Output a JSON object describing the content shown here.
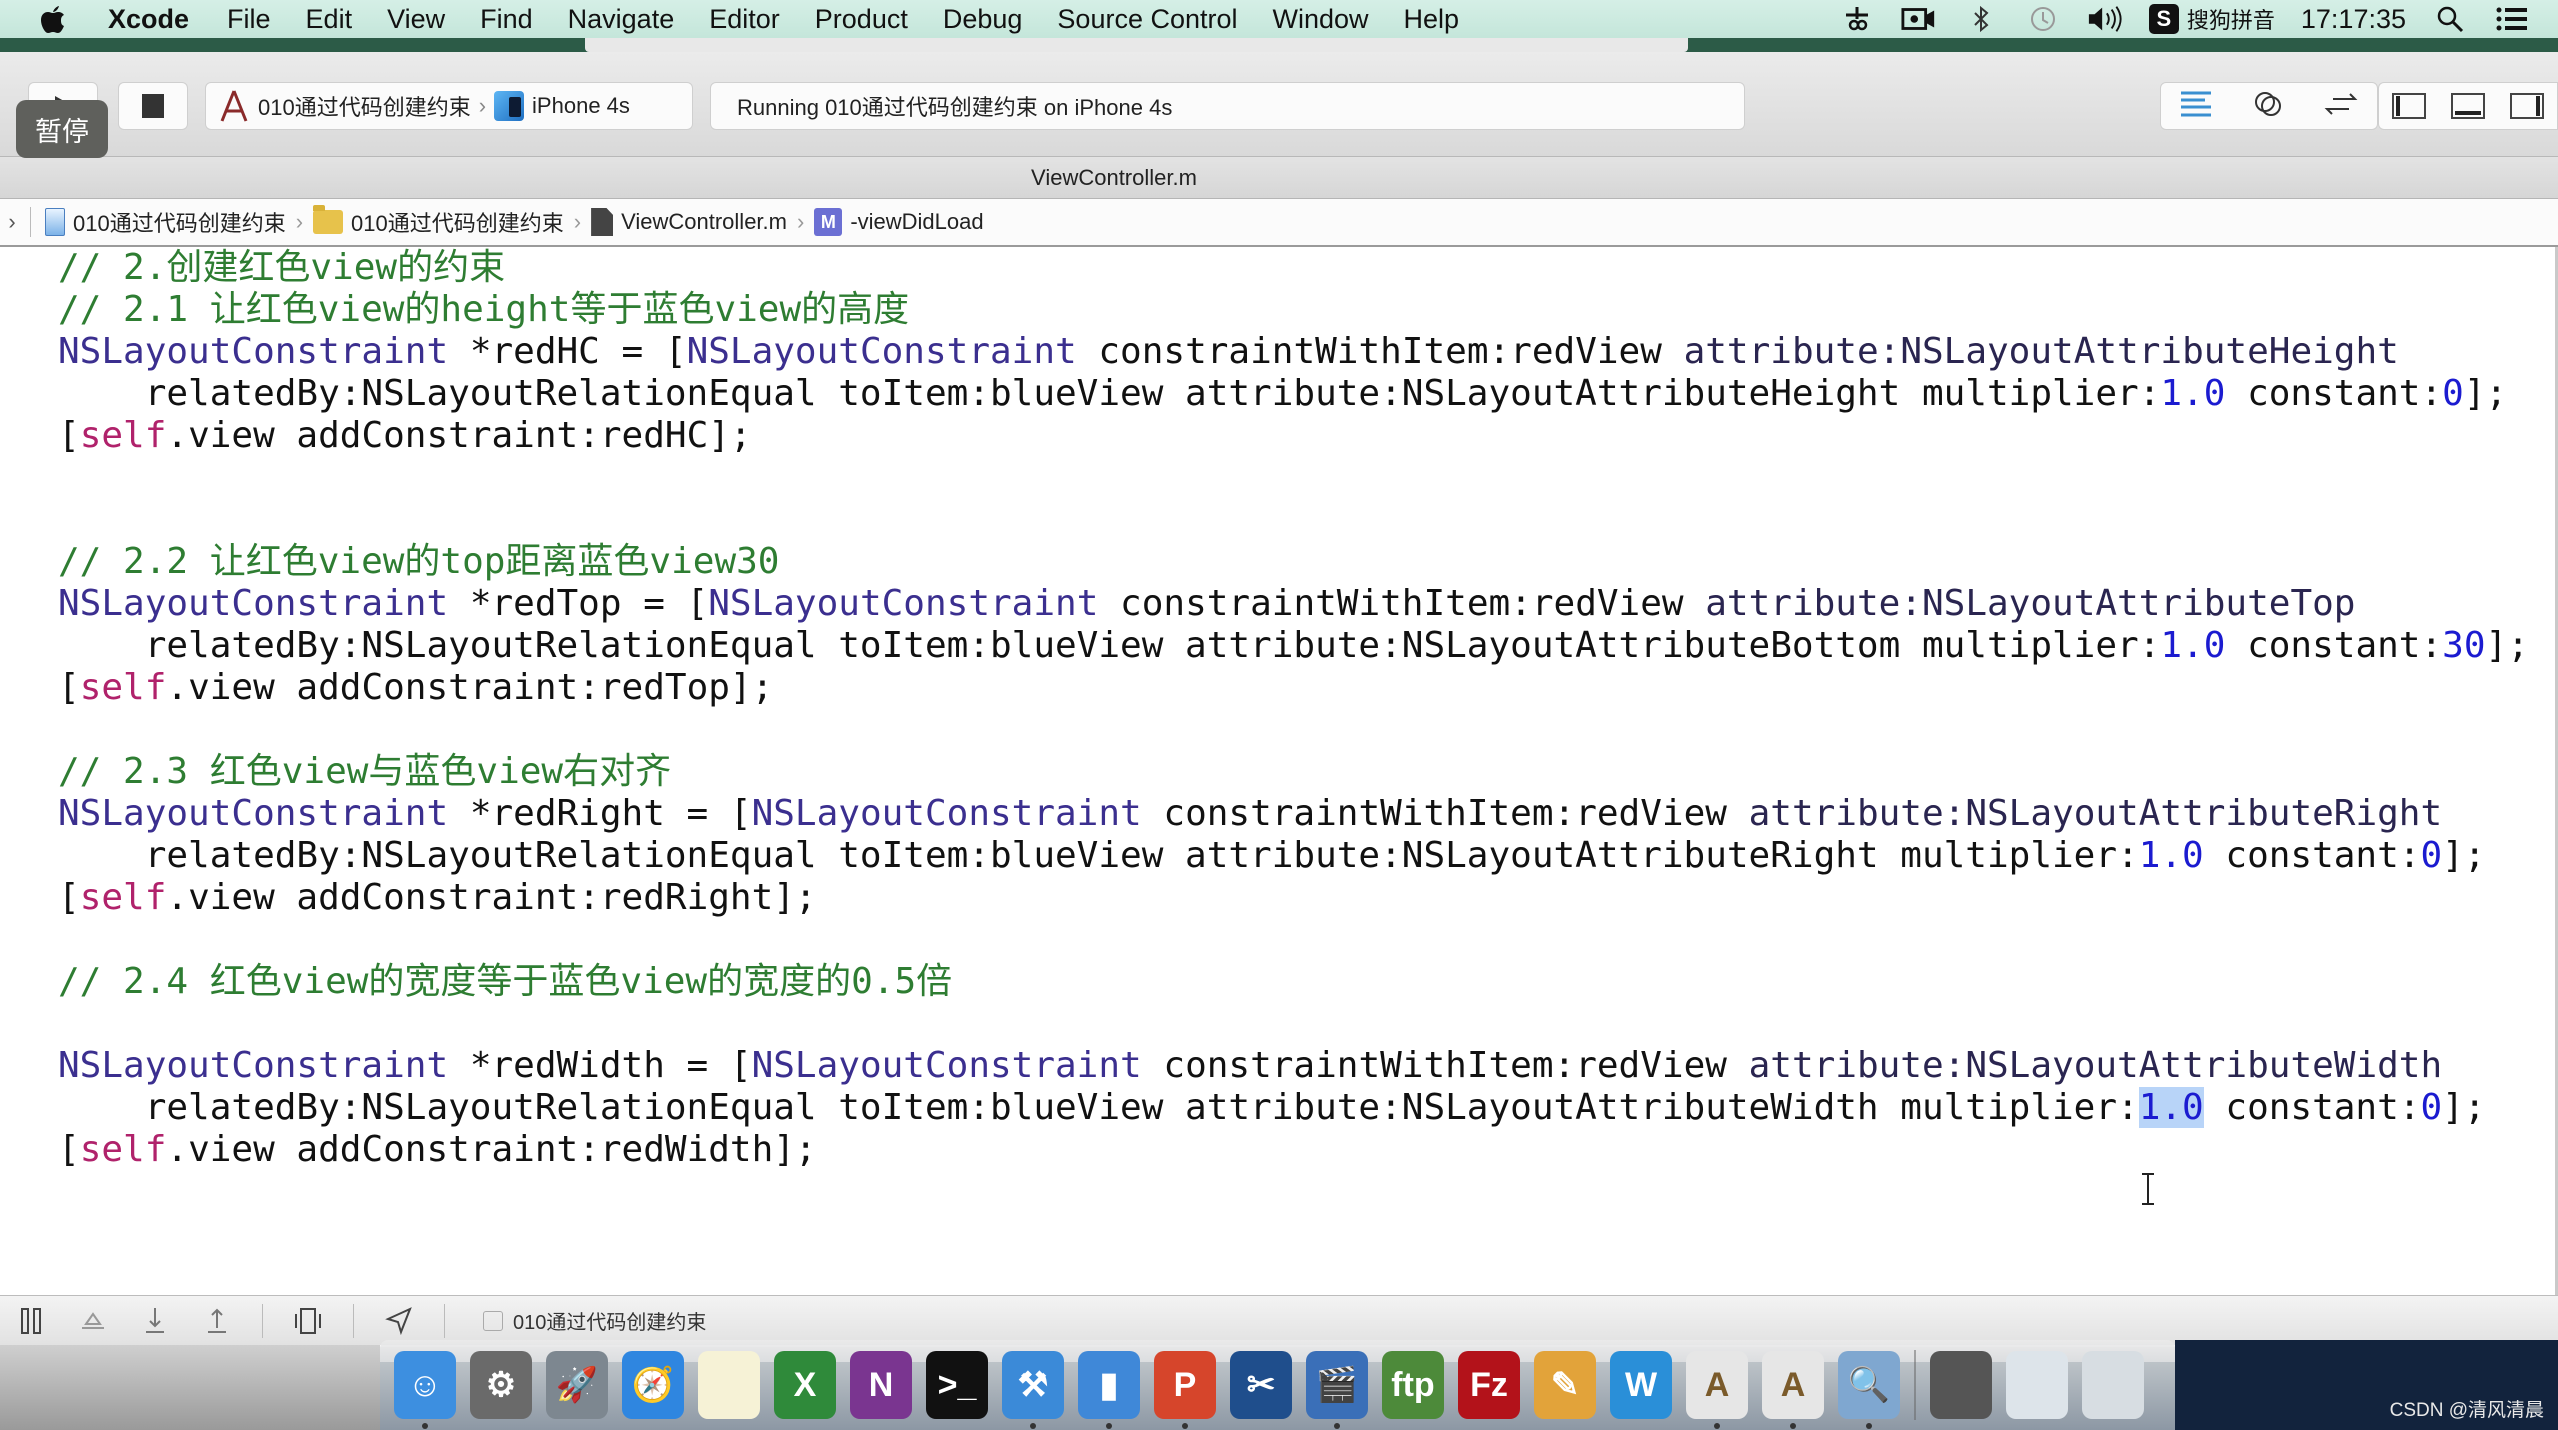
{
  "menubar": {
    "app_name": "Xcode",
    "items": [
      "File",
      "Edit",
      "View",
      "Find",
      "Navigate",
      "Editor",
      "Product",
      "Debug",
      "Source Control",
      "Window",
      "Help"
    ],
    "status_icons": [
      "scissors-icon",
      "screen-recorder-icon",
      "bluetooth-icon",
      "time-machine-icon",
      "volume-icon"
    ],
    "ime_badge": "S",
    "ime_label": "搜狗拼音",
    "clock": "17:17:35"
  },
  "overlay": {
    "pause_label": "暂停"
  },
  "toolbar": {
    "scheme_name": "010通过代码创建约束",
    "scheme_separator": "›",
    "device": "iPhone 4s",
    "activity_status": "Running 010通过代码创建约束 on iPhone 4s"
  },
  "tab": {
    "title": "ViewController.m"
  },
  "jumpbar": {
    "nav_chevron": "›",
    "crumbs": [
      {
        "label": "010通过代码创建约束",
        "icon": "project-icon"
      },
      {
        "label": "010通过代码创建约束",
        "icon": "folder-icon"
      },
      {
        "label": "ViewController.m",
        "icon": "m-file-icon"
      },
      {
        "label": "-viewDidLoad",
        "icon": "method-icon",
        "icon_text": "M"
      }
    ],
    "separator": "›"
  },
  "code": {
    "lines": [
      [
        {
          "t": "// 2.创建红色view的约束",
          "c": "comment"
        }
      ],
      [
        {
          "t": "// 2.1 让红色view的height等于蓝色view的高度",
          "c": "comment"
        }
      ],
      [
        {
          "t": "NSLayoutConstraint",
          "c": "type"
        },
        {
          "t": " *redHC = [",
          "c": "plain"
        },
        {
          "t": "NSLayoutConstraint",
          "c": "type"
        },
        {
          "t": " constraintWithItem:redView ",
          "c": "plain"
        },
        {
          "t": "attribute:NSLayoutAttributeHeight",
          "c": "method"
        }
      ],
      [
        {
          "t": "    relatedBy:NSLayoutRelationEqual toItem:blueView attribute:NSLayoutAttributeHeight multiplier:",
          "c": "plain"
        },
        {
          "t": "1.0",
          "c": "num"
        },
        {
          "t": " constant:",
          "c": "plain"
        },
        {
          "t": "0",
          "c": "num"
        },
        {
          "t": "];",
          "c": "plain"
        }
      ],
      [
        {
          "t": "[",
          "c": "plain"
        },
        {
          "t": "self",
          "c": "self"
        },
        {
          "t": ".view addConstraint:redHC];",
          "c": "plain"
        }
      ],
      [],
      [],
      [
        {
          "t": "// 2.2 让红色view的top距离蓝色view30",
          "c": "comment"
        }
      ],
      [
        {
          "t": "NSLayoutConstraint",
          "c": "type"
        },
        {
          "t": " *redTop = [",
          "c": "plain"
        },
        {
          "t": "NSLayoutConstraint",
          "c": "type"
        },
        {
          "t": " constraintWithItem:redView ",
          "c": "plain"
        },
        {
          "t": "attribute:NSLayoutAttributeTop",
          "c": "method"
        }
      ],
      [
        {
          "t": "    relatedBy:NSLayoutRelationEqual toItem:blueView attribute:NSLayoutAttributeBottom multiplier:",
          "c": "plain"
        },
        {
          "t": "1.0",
          "c": "num"
        },
        {
          "t": " constant:",
          "c": "plain"
        },
        {
          "t": "30",
          "c": "num"
        },
        {
          "t": "];",
          "c": "plain"
        }
      ],
      [
        {
          "t": "[",
          "c": "plain"
        },
        {
          "t": "self",
          "c": "self"
        },
        {
          "t": ".view addConstraint:redTop];",
          "c": "plain"
        }
      ],
      [],
      [
        {
          "t": "// 2.3 红色view与蓝色view右对齐",
          "c": "comment"
        }
      ],
      [
        {
          "t": "NSLayoutConstraint",
          "c": "type"
        },
        {
          "t": " *redRight = [",
          "c": "plain"
        },
        {
          "t": "NSLayoutConstraint",
          "c": "type"
        },
        {
          "t": " constraintWithItem:redView ",
          "c": "plain"
        },
        {
          "t": "attribute:NSLayoutAttributeRight",
          "c": "method"
        }
      ],
      [
        {
          "t": "    relatedBy:NSLayoutRelationEqual toItem:blueView attribute:NSLayoutAttributeRight multiplier:",
          "c": "plain"
        },
        {
          "t": "1.0",
          "c": "num"
        },
        {
          "t": " constant:",
          "c": "plain"
        },
        {
          "t": "0",
          "c": "num"
        },
        {
          "t": "];",
          "c": "plain"
        }
      ],
      [
        {
          "t": "[",
          "c": "plain"
        },
        {
          "t": "self",
          "c": "self"
        },
        {
          "t": ".view addConstraint:redRight];",
          "c": "plain"
        }
      ],
      [],
      [
        {
          "t": "// 2.4 红色view的宽度等于蓝色view的宽度的0.5倍",
          "c": "comment"
        }
      ],
      [],
      [
        {
          "t": "NSLayoutConstraint",
          "c": "type"
        },
        {
          "t": " *redWidth = [",
          "c": "plain"
        },
        {
          "t": "NSLayoutConstraint",
          "c": "type"
        },
        {
          "t": " constraintWithItem:redView ",
          "c": "plain"
        },
        {
          "t": "attribute:NSLayoutAttributeWidth",
          "c": "method"
        }
      ],
      [
        {
          "t": "    relatedBy:NSLayoutRelationEqual toItem:blueView attribute:NSLayoutAttributeWidth multiplier:",
          "c": "plain"
        },
        {
          "t": "1.0",
          "c": "num-sel"
        },
        {
          "t": " constant:",
          "c": "plain"
        },
        {
          "t": "0",
          "c": "num"
        },
        {
          "t": "];",
          "c": "plain"
        }
      ],
      [
        {
          "t": "[",
          "c": "plain"
        },
        {
          "t": "self",
          "c": "self"
        },
        {
          "t": ".view addConstraint:redWidth];",
          "c": "plain"
        }
      ]
    ]
  },
  "debugbar": {
    "target_label": "010通过代码创建约束"
  },
  "dock": {
    "apps": [
      {
        "name": "finder",
        "glyph": "☺",
        "color": "#3d8fe0",
        "running": true
      },
      {
        "name": "system-preferences",
        "glyph": "⚙",
        "color": "#6a6a6a",
        "running": false
      },
      {
        "name": "launchpad",
        "glyph": "🚀",
        "color": "#7d8790",
        "running": false
      },
      {
        "name": "safari",
        "glyph": "🧭",
        "color": "#2f86e0",
        "running": false
      },
      {
        "name": "notes",
        "glyph": "",
        "color": "#f6f2d6",
        "running": false
      },
      {
        "name": "excel",
        "glyph": "X",
        "color": "#2f8a3a",
        "running": false
      },
      {
        "name": "onenote",
        "glyph": "N",
        "color": "#7a3590",
        "running": false
      },
      {
        "name": "terminal",
        "glyph": ">_",
        "color": "#111111",
        "running": false
      },
      {
        "name": "xcode",
        "glyph": "⚒",
        "color": "#3b8ad8",
        "running": true
      },
      {
        "name": "simulator",
        "glyph": "▮",
        "color": "#3f88d8",
        "running": true
      },
      {
        "name": "powerpoint",
        "glyph": "P",
        "color": "#d6452b",
        "running": true
      },
      {
        "name": "screenshot-tool",
        "glyph": "✂",
        "color": "#1f4e8c",
        "running": false
      },
      {
        "name": "imovie",
        "glyph": "🎬",
        "color": "#3a6fb8",
        "running": true
      },
      {
        "name": "ftp-client",
        "glyph": "ftp",
        "color": "#4d8a3a",
        "running": false
      },
      {
        "name": "filezilla",
        "glyph": "Fz",
        "color": "#b3121a",
        "running": false
      },
      {
        "name": "pencil-app",
        "glyph": "✎",
        "color": "#e2a33a",
        "running": false
      },
      {
        "name": "word",
        "glyph": "W",
        "color": "#2a8fd8",
        "running": false
      },
      {
        "name": "font-book",
        "glyph": "A",
        "color": "#e6e6e6",
        "running": true
      },
      {
        "name": "font-book-2",
        "glyph": "A",
        "color": "#e6e6e6",
        "running": true
      },
      {
        "name": "preview",
        "glyph": "🔍",
        "color": "#7fa7d0",
        "running": true
      }
    ],
    "right_items": [
      {
        "name": "screen-recording-stack",
        "color": "#555"
      },
      {
        "name": "downloads-stack",
        "color": "#dde4ea"
      },
      {
        "name": "trash",
        "color": "#d7dde2"
      }
    ]
  },
  "watermark": "CSDN @清风清晨"
}
